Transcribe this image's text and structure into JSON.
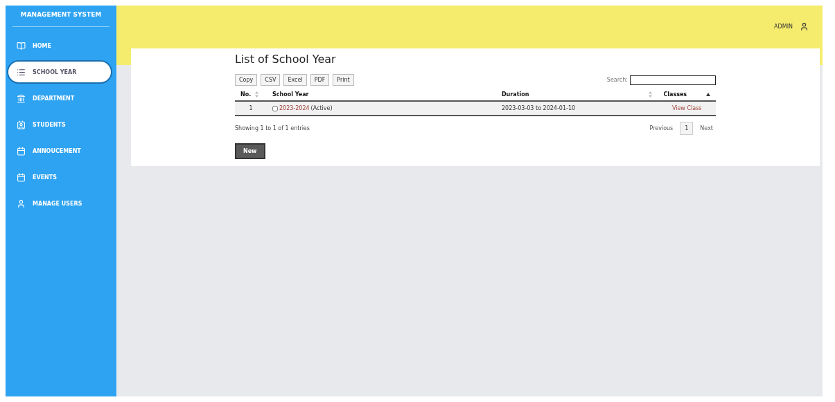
{
  "sidebar": {
    "title": "MANAGEMENT SYSTEM",
    "items": [
      {
        "label": "HOME",
        "selected": false
      },
      {
        "label": "SCHOOL YEAR",
        "selected": true
      },
      {
        "label": "DEPARTMENT",
        "selected": false
      },
      {
        "label": "STUDENTS",
        "selected": false
      },
      {
        "label": "ANNOUCEMENT",
        "selected": false
      },
      {
        "label": "EVENTS",
        "selected": false
      },
      {
        "label": "MANAGE USERS",
        "selected": false
      }
    ]
  },
  "header": {
    "user": "ADMIN"
  },
  "page": {
    "title": "List of School Year",
    "export_buttons": [
      "Copy",
      "CSV",
      "Excel",
      "PDF",
      "Print"
    ],
    "search": {
      "label": "Search:"
    },
    "table": {
      "columns": [
        {
          "label": "No.",
          "sortable": true,
          "sorted": false
        },
        {
          "label": "School Year",
          "sortable": false,
          "sorted": false
        },
        {
          "label": "Duration",
          "sortable": true,
          "sorted": false
        },
        {
          "label": "Classes",
          "sortable": false,
          "sorted": true
        }
      ],
      "rows": [
        {
          "no": "1",
          "checked": false,
          "year": "2023-2024",
          "status": "(Active)",
          "duration": "2023-03-03 to 2024-01-10",
          "action": "View Class"
        }
      ]
    },
    "info": "Showing 1 to 1 of 1 entries",
    "pagination": {
      "previous": "Previous",
      "pages": [
        {
          "label": "1",
          "selected": true
        }
      ],
      "next": "Next"
    },
    "new_button": "New"
  }
}
